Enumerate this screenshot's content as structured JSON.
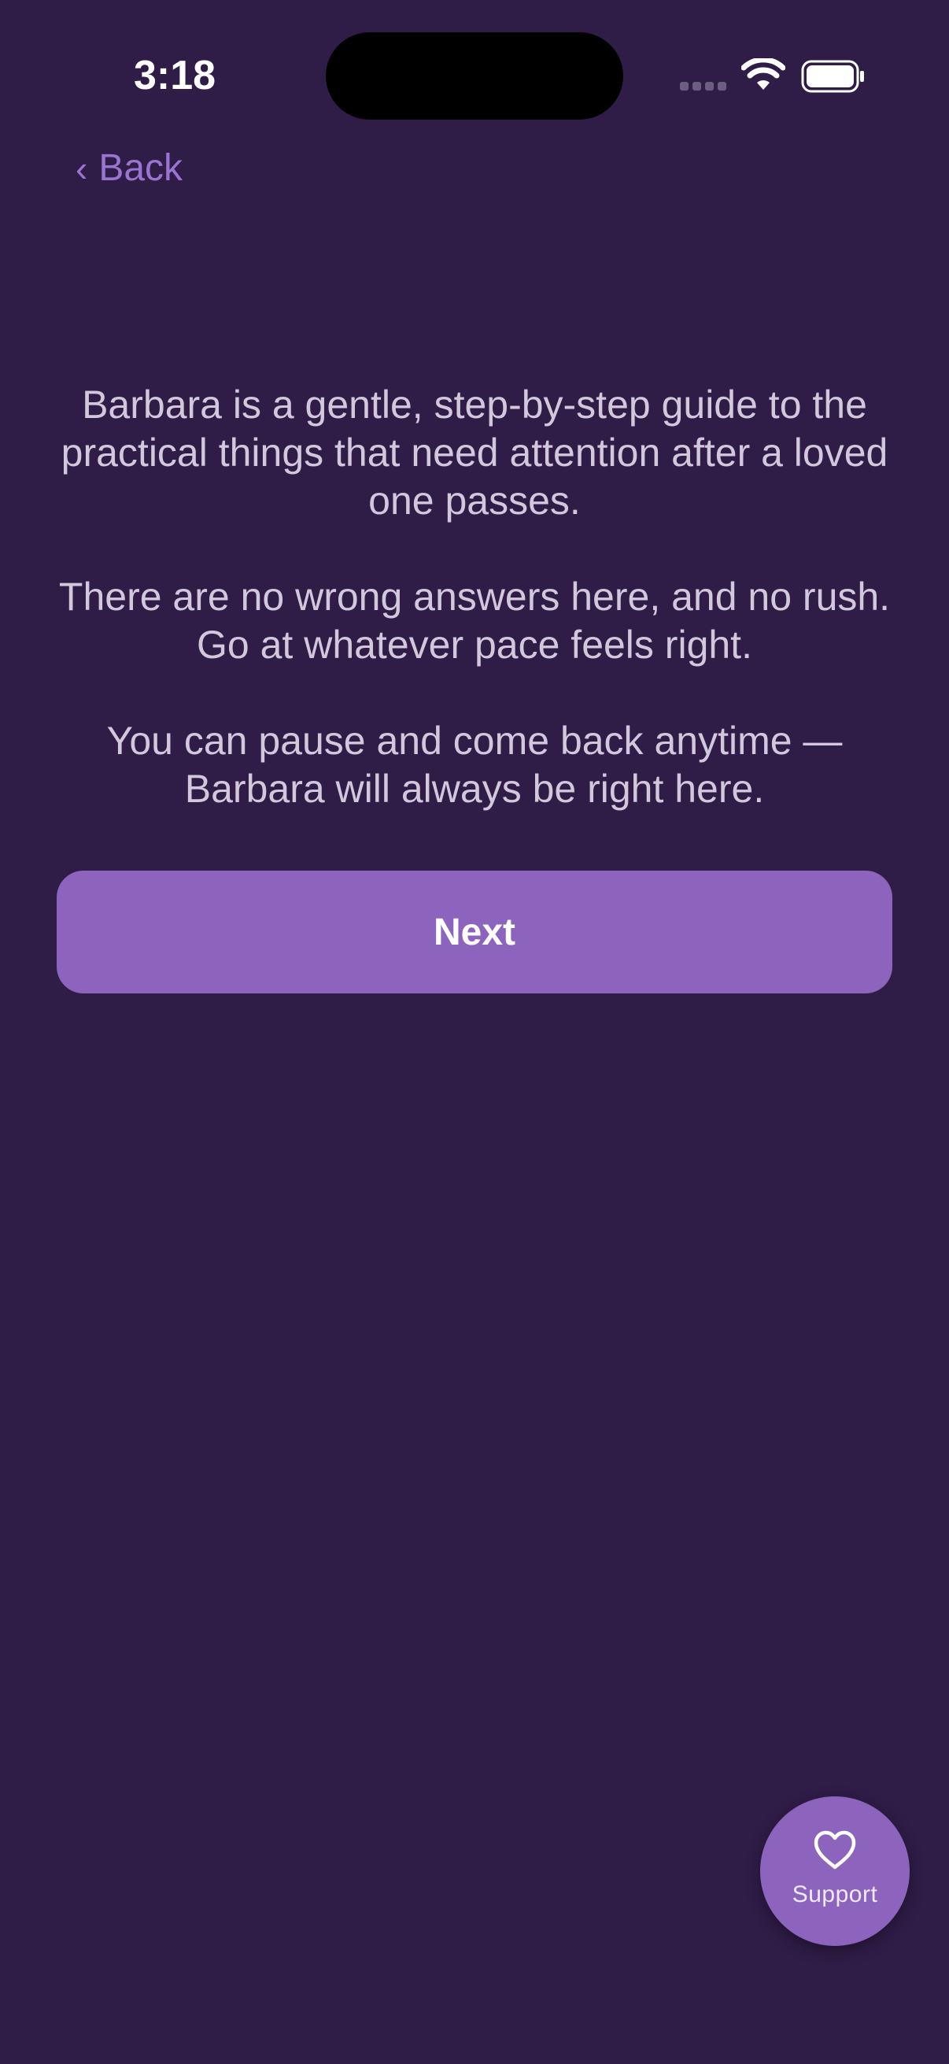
{
  "status_bar": {
    "time": "3:18",
    "icons": [
      "signal-dots-icon",
      "wifi-icon",
      "battery-icon"
    ]
  },
  "nav": {
    "back_chevron": "‹",
    "back_label": "Back"
  },
  "intro": {
    "paragraphs": [
      "Barbara is a gentle, step-by-step guide to the practical things that need attention after a loved one passes.",
      "There are no wrong answers here, and no rush. Go at whatever pace feels right.",
      "You can pause and come back anytime — Barbara will always be right here."
    ]
  },
  "actions": {
    "next_label": "Next"
  },
  "support": {
    "label": "Support",
    "icon": "heart-icon"
  },
  "colors": {
    "background": "#2f1c47",
    "accent": "#8c64bd",
    "link": "#9a74cf",
    "body_text": "#d2c8dc"
  }
}
